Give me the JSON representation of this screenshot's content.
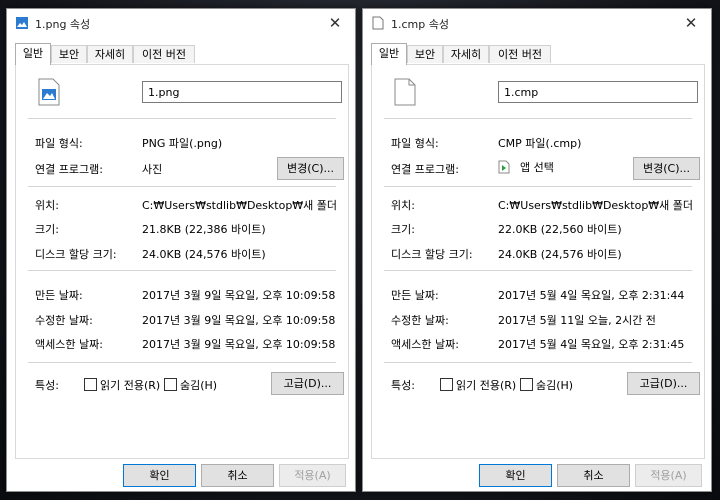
{
  "dialogs": [
    {
      "title": "1.png 속성",
      "close_glyph": "✕",
      "tabs": [
        "일반",
        "보안",
        "자세히",
        "이전 버전"
      ],
      "file_icon": "image-file-icon",
      "file_name": "1.png",
      "rows1": [
        {
          "label": "파일 형식:",
          "value": "PNG 파일(.png)"
        },
        {
          "label": "연결 프로그램:",
          "value": "사진"
        }
      ],
      "change_button": "변경(C)...",
      "rows2": [
        {
          "label": "위치:",
          "value": "C:₩Users₩stdlib₩Desktop₩새 폴더"
        },
        {
          "label": "크기:",
          "value": "21.8KB (22,386 바이트)"
        },
        {
          "label": "디스크 할당 크기:",
          "value": "24.0KB (24,576 바이트)"
        }
      ],
      "rows3": [
        {
          "label": "만든 날짜:",
          "value": "2017년 3월 9일 목요일, 오후 10:09:58"
        },
        {
          "label": "수정한 날짜:",
          "value": "2017년 3월 9일 목요일, 오후 10:09:58"
        },
        {
          "label": "액세스한 날짜:",
          "value": "2017년 3월 9일 목요일, 오후 10:09:58"
        }
      ],
      "attributes_label": "특성:",
      "readonly_label": "읽기 전용(R)",
      "hidden_label": "숨김(H)",
      "advanced_button": "고급(D)...",
      "ok_button": "확인",
      "cancel_button": "취소",
      "apply_button": "적용(A)"
    },
    {
      "title": "1.cmp 속성",
      "close_glyph": "✕",
      "tabs": [
        "일반",
        "보안",
        "자세히",
        "이전 버전"
      ],
      "file_icon": "blank-file-icon",
      "file_name": "1.cmp",
      "rows1": [
        {
          "label": "파일 형식:",
          "value": "CMP 파일(.cmp)"
        },
        {
          "label": "연결 프로그램:",
          "value": "앱 선택"
        }
      ],
      "change_button": "변경(C)...",
      "rows2": [
        {
          "label": "위치:",
          "value": "C:₩Users₩stdlib₩Desktop₩새 폴더"
        },
        {
          "label": "크기:",
          "value": "22.0KB (22,560 바이트)"
        },
        {
          "label": "디스크 할당 크기:",
          "value": "24.0KB (24,576 바이트)"
        }
      ],
      "rows3": [
        {
          "label": "만든 날짜:",
          "value": "2017년 5월 4일 목요일, 오후 2:31:44"
        },
        {
          "label": "수정한 날짜:",
          "value": "2017년 5월 11일 오늘, 2시간 전"
        },
        {
          "label": "액세스한 날짜:",
          "value": "2017년 5월 4일 목요일, 오후 2:31:45"
        }
      ],
      "attributes_label": "특성:",
      "readonly_label": "읽기 전용(R)",
      "hidden_label": "숨김(H)",
      "advanced_button": "고급(D)...",
      "ok_button": "확인",
      "cancel_button": "취소",
      "apply_button": "적용(A)"
    }
  ]
}
